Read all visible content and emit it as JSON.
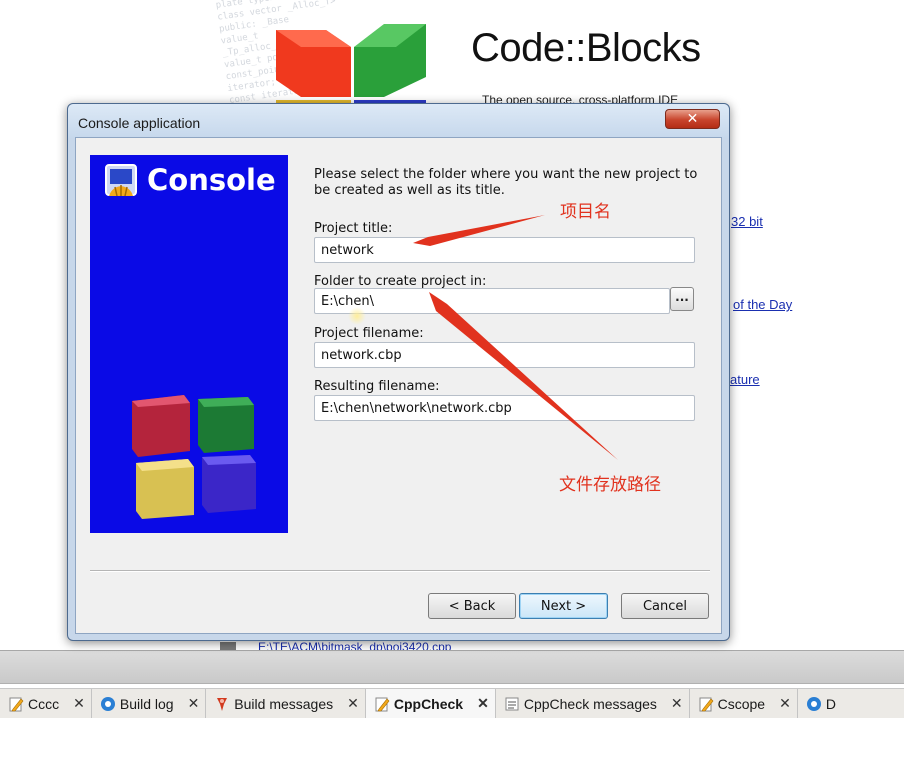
{
  "background": {
    "app_name": "Code::Blocks",
    "tagline": "The open source, cross-platform IDE",
    "code_lines": [
      "plate typena",
      "class vector _Alloc_T>",
      "public: _Base",
      "value_t",
      "_Tp_alloc_type",
      "value_t pointer;",
      "const_pointer;",
      "iterator;",
      "const_iterator"
    ],
    "links": [
      "32 bit",
      "of the Day",
      "ature"
    ],
    "file_link": "E:\\TE\\ACM\\bitmask_dp\\poj3420.cpp"
  },
  "dialog": {
    "title": "Console application",
    "close_label": "✕",
    "side_title": "Console",
    "intro": "Please select the folder where you want the new project to be created as well as its title.",
    "fields": {
      "project_title_label": "Project title:",
      "project_title_value": "network",
      "folder_label": "Folder to create project in:",
      "folder_value": "E:\\chen\\",
      "browse_label": "...",
      "filename_label": "Project filename:",
      "filename_value": "network.cbp",
      "result_label": "Resulting filename:",
      "result_value": "E:\\chen\\network\\network.cbp"
    },
    "buttons": {
      "back": "< Back",
      "next": "Next >",
      "cancel": "Cancel"
    }
  },
  "annotations": {
    "project_name_note": "项目名",
    "path_note": "文件存放路径",
    "color": "#e1321e"
  },
  "tabs": [
    {
      "label": "Cccc",
      "icon": "edit-icon",
      "close": "✕"
    },
    {
      "label": "Build log",
      "icon": "gear-icon",
      "close": "✕"
    },
    {
      "label": "Build messages",
      "icon": "pin-icon",
      "close": "✕"
    },
    {
      "label": "CppCheck",
      "icon": "edit-icon",
      "close": "✕",
      "active": true
    },
    {
      "label": "CppCheck messages",
      "icon": "list-icon",
      "close": "✕"
    },
    {
      "label": "Cscope",
      "icon": "edit-icon",
      "close": "✕"
    },
    {
      "label": "D",
      "icon": "gear-icon",
      "close": ""
    }
  ]
}
